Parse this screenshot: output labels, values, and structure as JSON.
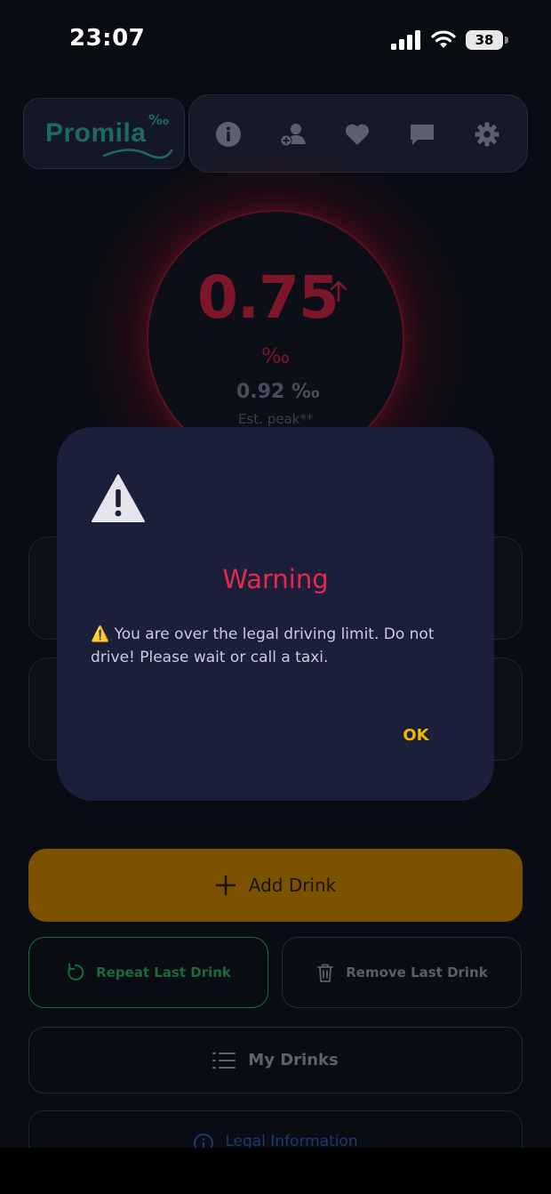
{
  "status_bar": {
    "time": "23:07",
    "battery": "38"
  },
  "header": {
    "logo_text": "Promila",
    "logo_permille": "‰",
    "nav": [
      {
        "name": "info-icon"
      },
      {
        "name": "add-person-icon"
      },
      {
        "name": "heart-icon"
      },
      {
        "name": "chat-icon"
      },
      {
        "name": "gear-icon"
      }
    ]
  },
  "gauge": {
    "bac": "0.75",
    "unit": "‰",
    "peak": "0.92 ‰",
    "peak_label": "Est. peak**",
    "trend": "rising"
  },
  "buttons": {
    "add_drink": "Add Drink",
    "repeat_last": "Repeat Last Drink",
    "remove_last": "Remove Last Drink",
    "my_drinks": "My Drinks",
    "legal": "Legal Information"
  },
  "dialog": {
    "title": "Warning",
    "message": "⚠️ You are over the legal driving limit. Do not drive! Please wait or call a taxi.",
    "ok": "OK"
  },
  "colors": {
    "accent_yellow": "#f0b800",
    "warning_red": "#e8284e",
    "dialog_bg": "#1b1f3a",
    "repeat_green": "#1c6a3a"
  }
}
